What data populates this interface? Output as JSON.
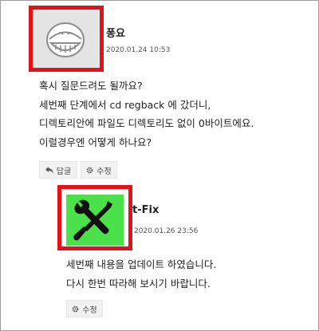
{
  "comment1": {
    "author": "퐁요",
    "date": "2020.01.24 10:53",
    "lines": [
      "혹시 질문드려도 될까요?",
      "세번째 단계에서 cd regback 에 갔더니,",
      "디렉토리안에 파일도 디렉토리도 없이 0바이트에요.",
      "이럴경우엔 어떻게 하나요?"
    ],
    "reply_label": "답글",
    "edit_label": "수정",
    "avatar_icon": "smiling-face-icon"
  },
  "comment2": {
    "author": "t-Fix",
    "date": "2020.01.26 23:56",
    "lines": [
      "세번째 내용을 업데이트 하였습니다.",
      "다시 한번 따라해 보시기 바랍니다."
    ],
    "edit_label": "수정",
    "avatar_icon": "tools-icon",
    "avatar_color": "#4ae14a"
  },
  "highlight_color": "#e3121a"
}
